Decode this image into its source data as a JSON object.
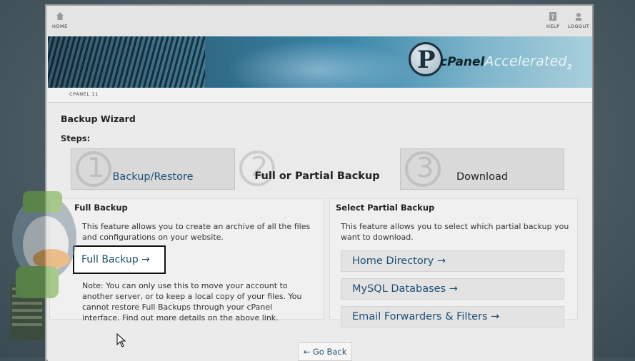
{
  "topbar": {
    "home_label": "HOME",
    "help_label": "HELP",
    "logout_label": "LOGOUT"
  },
  "banner": {
    "logo_letter": "P",
    "brand_cpanel": "cPanel",
    "brand_accelerated": "Accelerated",
    "brand_version": "2"
  },
  "breadcrumb": "CPANEL 11",
  "page_title": "Backup Wizard",
  "steps_label": "Steps:",
  "steps": [
    {
      "number": "1",
      "label": "Backup/Restore"
    },
    {
      "number": "2",
      "label": "Full or Partial Backup"
    },
    {
      "number": "3",
      "label": "Download"
    }
  ],
  "full_backup": {
    "heading": "Full Backup",
    "description": "This feature allows you to create an archive of all the files and configurations on your website.",
    "button_label": "Full Backup →",
    "note": "Note: You can only use this to move your account to another server, or to keep a local copy of your files. You cannot restore Full Backups through your cPanel interface. Find out more details on the above link."
  },
  "partial_backup": {
    "heading": "Select Partial Backup",
    "description": "This feature allows you to select which partial backup you want to download.",
    "links": [
      "Home Directory →",
      "MySQL Databases →",
      "Email Forwarders & Filters →"
    ]
  },
  "go_back_label": "← Go Back",
  "colors": {
    "link": "#1d4f74",
    "banner_dark": "#1d3a4c",
    "banner_light": "#a9cfdc"
  }
}
